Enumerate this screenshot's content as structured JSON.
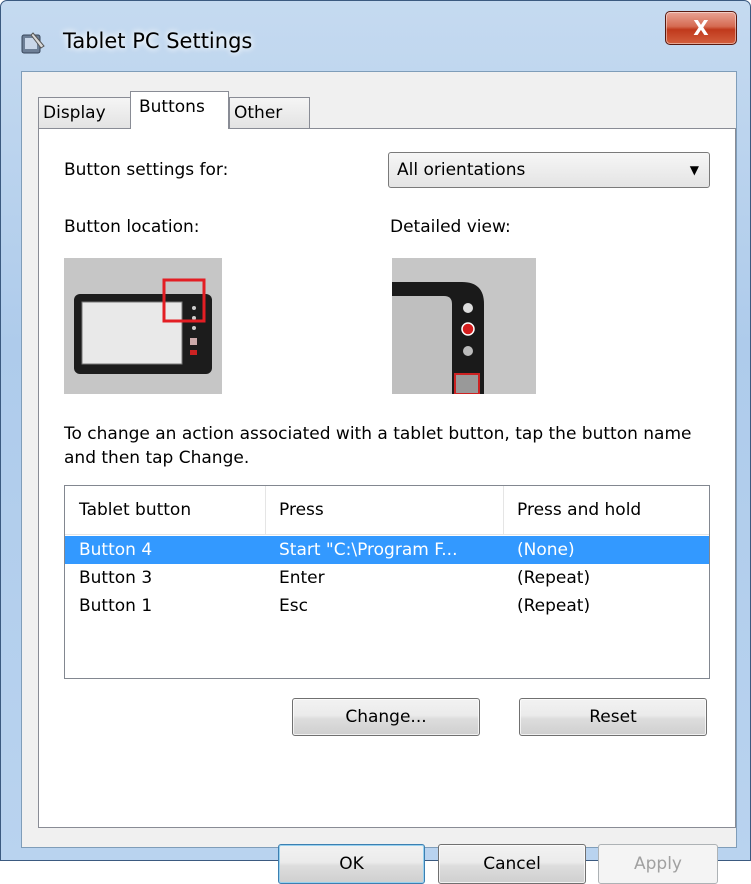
{
  "window": {
    "title": "Tablet PC Settings",
    "close_label": "X"
  },
  "tabs": [
    {
      "label": "Display",
      "active": false
    },
    {
      "label": "Buttons",
      "active": true
    },
    {
      "label": "Other",
      "active": false
    }
  ],
  "buttons_tab": {
    "settings_for_label": "Button settings for:",
    "orientation_value": "All orientations",
    "location_label": "Button location:",
    "detailed_label": "Detailed view:",
    "instructions": "To change an action associated with a tablet button, tap the button name and then tap Change.",
    "table": {
      "headers": [
        "Tablet button",
        "Press",
        "Press and hold"
      ],
      "rows": [
        {
          "button": "Button 4",
          "press": "Start \"C:\\Program F...",
          "hold": "(None)",
          "selected": true
        },
        {
          "button": "Button 3",
          "press": "Enter",
          "hold": "(Repeat)",
          "selected": false
        },
        {
          "button": "Button 1",
          "press": "Esc",
          "hold": "(Repeat)",
          "selected": false
        }
      ]
    },
    "change_label": "Change...",
    "reset_label": "Reset"
  },
  "footer": {
    "ok_label": "OK",
    "cancel_label": "Cancel",
    "apply_label": "Apply"
  },
  "colors": {
    "selection": "#3399ff",
    "highlight_box": "#e31e24"
  }
}
